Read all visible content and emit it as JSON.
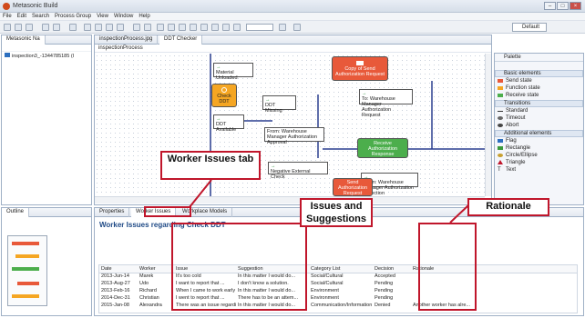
{
  "window": {
    "title": "Metasonic Build"
  },
  "menu": [
    "File",
    "Edit",
    "Search",
    "Process Group",
    "View",
    "Window",
    "Help"
  ],
  "perspective": "Default",
  "nav": {
    "tab": "Metasonic Na",
    "tree_item": "inspection3_-1344785185 (I"
  },
  "editor": {
    "tabs": [
      "inspectionProcess.jpg",
      "DDT Checker"
    ],
    "subtab": "inspectionProcess"
  },
  "diagram": {
    "nodes": {
      "material": "Material Unloaded",
      "check": "Check DDT",
      "ddt_missing": "DDT Missing",
      "ddt_available": "DDT Available",
      "copy_send": "Copy of Send Authorization Request",
      "to_wh": "To: Warehouse Manager Authorization Request",
      "from_wh1": "From: Warehouse Manager Authorization Approval",
      "receive_auth": "Receive Authorization Response",
      "neg_ext": "Negative External Check",
      "send_auth": "Send Authorization Request",
      "from_wh2": "From: Warehouse Manager Authorization Rejection"
    }
  },
  "palette": {
    "title": "Palette",
    "groups": [
      {
        "name": "Basic elements",
        "items": [
          "Send state",
          "Function state",
          "Receive state"
        ]
      },
      {
        "name": "Transitions",
        "items": [
          "Standard",
          "Timeout",
          "Abort"
        ]
      },
      {
        "name": "Additional elements",
        "items": [
          "Flag",
          "Rectangle",
          "Circle/Ellipse",
          "Triangle",
          "Text"
        ]
      }
    ]
  },
  "outline": {
    "tab": "Outline"
  },
  "bottom": {
    "tabs": [
      "Properties",
      "Worker Issues",
      "Workplace Models"
    ],
    "heading": "Worker Issues regarding Check DDT"
  },
  "table": {
    "columns": [
      "Date",
      "Worker",
      "Issue",
      "Suggestion",
      "Category List",
      "Decision",
      "Rationale"
    ],
    "rows": [
      [
        "2013-Jun-14",
        "Marek",
        "It's too cold",
        "In this matter I would do...",
        "Social/Cultural",
        "Accepted",
        ""
      ],
      [
        "2013-Aug-27",
        "Udo",
        "I want to report that ...",
        "I don't know a solution.",
        "Social/Cultural",
        "Pending",
        ""
      ],
      [
        "2013-Feb-16",
        "Richard",
        "When I came to work early thi...",
        "In this matter I would do...",
        "Environment",
        "Pending",
        ""
      ],
      [
        "2014-Dec-31",
        "Christian",
        "I went to report that ...",
        "There has to be an attem...",
        "Environment",
        "Pending",
        ""
      ],
      [
        "2015-Jan-08",
        "Alexandra",
        "There was an issue regarding ...",
        "In this matter I would do...",
        "Communication/Information",
        "Denied",
        "Another worker has alre..."
      ]
    ]
  },
  "annotations": {
    "worker_tab": "Worker Issues tab",
    "issues": "Issues and Suggestions",
    "rationale": "Rationale"
  }
}
